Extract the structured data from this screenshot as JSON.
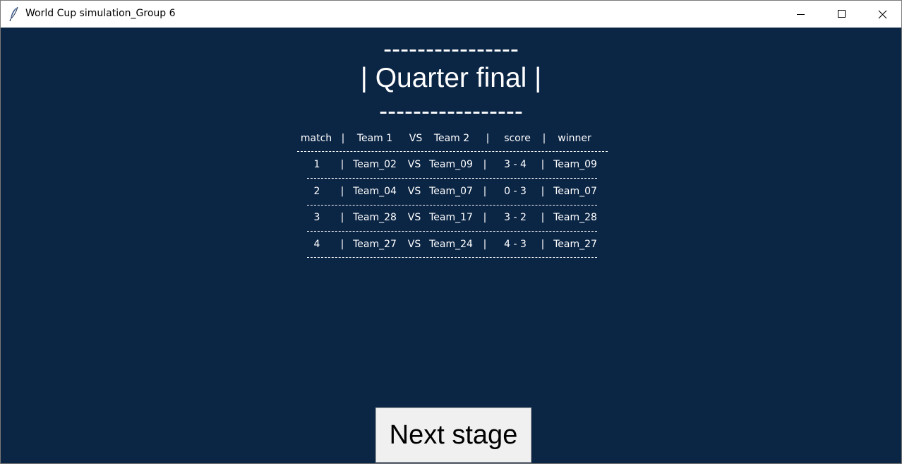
{
  "window": {
    "title": "World Cup simulation_Group 6",
    "controls": {
      "minimize_icon": "minimize-icon",
      "maximize_icon": "maximize-icon",
      "close_icon": "close-icon"
    }
  },
  "stage": {
    "dash_top": "----------------",
    "title": "| Quarter final |",
    "dash_bottom": "-----------------"
  },
  "table": {
    "header": {
      "match": "match",
      "sep1": "|",
      "team1": "Team 1",
      "vs": "VS",
      "team2": "Team 2",
      "sep2": "|",
      "score": "score",
      "sep3": "|",
      "winner": "winner"
    },
    "rows": [
      {
        "match": "1",
        "sep1": "|",
        "team1": "Team_02",
        "vs": "VS",
        "team2": "Team_09",
        "sep2": "|",
        "score": "3 - 4",
        "sep3": "|",
        "winner": "Team_09"
      },
      {
        "match": "2",
        "sep1": "|",
        "team1": "Team_04",
        "vs": "VS",
        "team2": "Team_07",
        "sep2": "|",
        "score": "0 - 3",
        "sep3": "|",
        "winner": "Team_07"
      },
      {
        "match": "3",
        "sep1": "|",
        "team1": "Team_28",
        "vs": "VS",
        "team2": "Team_17",
        "sep2": "|",
        "score": "3 - 2",
        "sep3": "|",
        "winner": "Team_28"
      },
      {
        "match": "4",
        "sep1": "|",
        "team1": "Team_27",
        "vs": "VS",
        "team2": "Team_24",
        "sep2": "|",
        "score": "4 - 3",
        "sep3": "|",
        "winner": "Team_27"
      }
    ]
  },
  "actions": {
    "next_label": "Next stage"
  },
  "colors": {
    "background": "#0b2545",
    "text": "#ffffff",
    "button_face": "#f0f0f0"
  }
}
